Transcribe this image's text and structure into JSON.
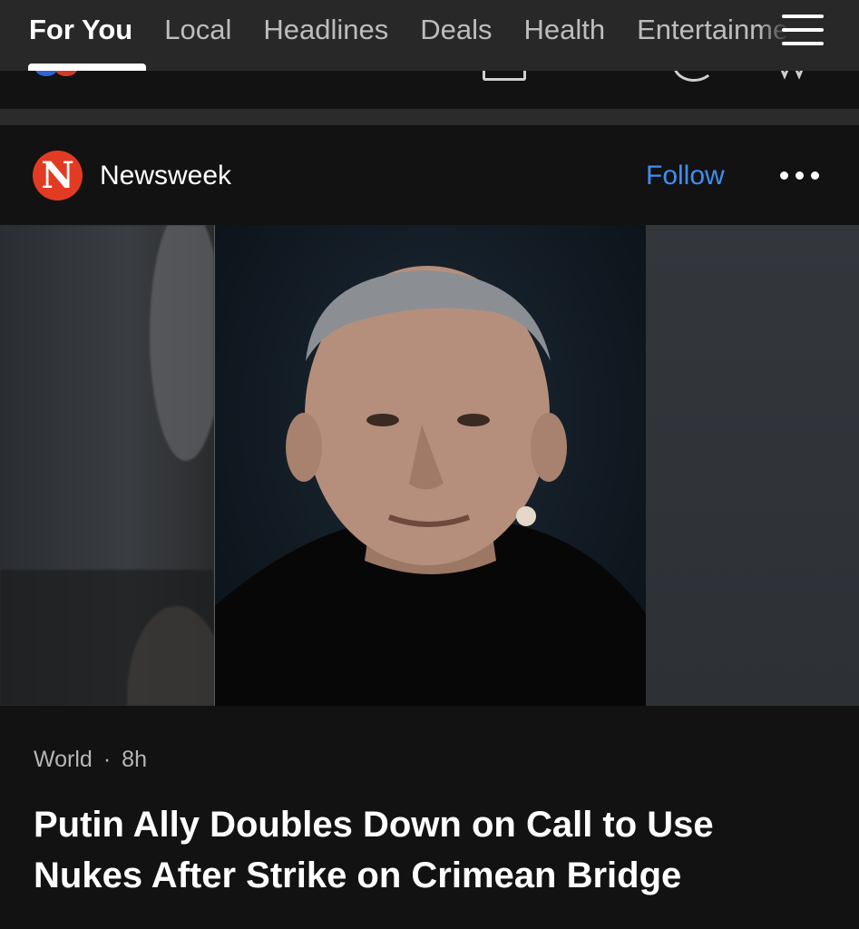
{
  "nav": {
    "tabs": [
      {
        "label": "For You",
        "active": true
      },
      {
        "label": "Local",
        "active": false
      },
      {
        "label": "Headlines",
        "active": false
      },
      {
        "label": "Deals",
        "active": false
      },
      {
        "label": "Health",
        "active": false
      },
      {
        "label": "Entertainment",
        "active": false
      }
    ],
    "menu_icon": "hamburger-menu-icon"
  },
  "card": {
    "publisher": {
      "name": "Newsweek",
      "logo_letter": "N",
      "logo_color": "#e23b24"
    },
    "follow_label": "Follow",
    "follow_color": "#3f8ef5",
    "more_icon": "more-options-icon",
    "article": {
      "category": "World",
      "separator": "·",
      "age": "8h",
      "headline": "Putin Ally Doubles Down on Call to Use Nukes After Strike on Crimean Bridge"
    }
  },
  "colors": {
    "background": "#121212",
    "nav_background": "#282828",
    "separator": "#2b2b2b",
    "active_text": "#ffffff",
    "inactive_text": "#bdbdbd",
    "meta_text": "#b6b6b6"
  }
}
